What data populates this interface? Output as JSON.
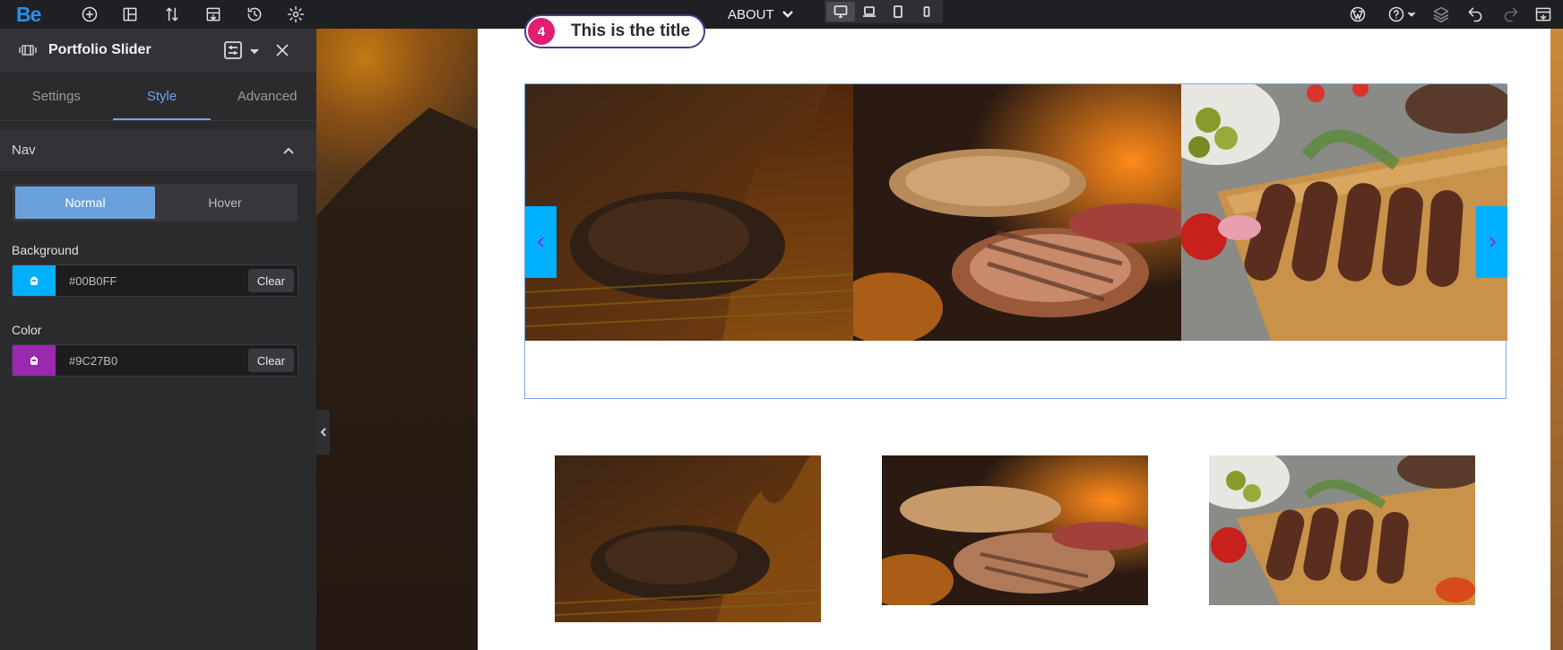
{
  "toolbar": {
    "logo": "Be",
    "page_name": "ABOUT",
    "icons": [
      "add-icon",
      "layout-icon",
      "sort-icon",
      "import-icon",
      "history-icon",
      "settings-icon",
      "wordpress-icon",
      "help-icon",
      "layers-icon",
      "undo-icon",
      "redo-icon",
      "preview-icon"
    ],
    "devices": [
      "desktop",
      "laptop",
      "tablet",
      "mobile"
    ],
    "active_device": "desktop"
  },
  "panel": {
    "title": "Portfolio Slider",
    "tabs": [
      {
        "label": "Settings"
      },
      {
        "label": "Style"
      },
      {
        "label": "Advanced"
      }
    ],
    "active_tab": "Style",
    "section": {
      "title": "Nav"
    },
    "states": {
      "normal": "Normal",
      "hover": "Hover",
      "active": "Normal"
    },
    "background": {
      "label": "Background",
      "value": "#00B0FF",
      "clear": "Clear",
      "swatch": "#00B0FF"
    },
    "color": {
      "label": "Color",
      "value": "#9C27B0",
      "clear": "Clear",
      "swatch": "#9C27B0"
    }
  },
  "canvas": {
    "heading": {
      "number": "4",
      "title": "This is the title"
    },
    "nav_background": "#00B0FF",
    "nav_color": "#9C27B0",
    "slides": [
      "grilled-steak-fire",
      "steaks-on-grill",
      "kebab-board"
    ],
    "thumbnails": [
      "grilled-steak-fire",
      "steaks-on-grill",
      "kebab-board"
    ]
  }
}
